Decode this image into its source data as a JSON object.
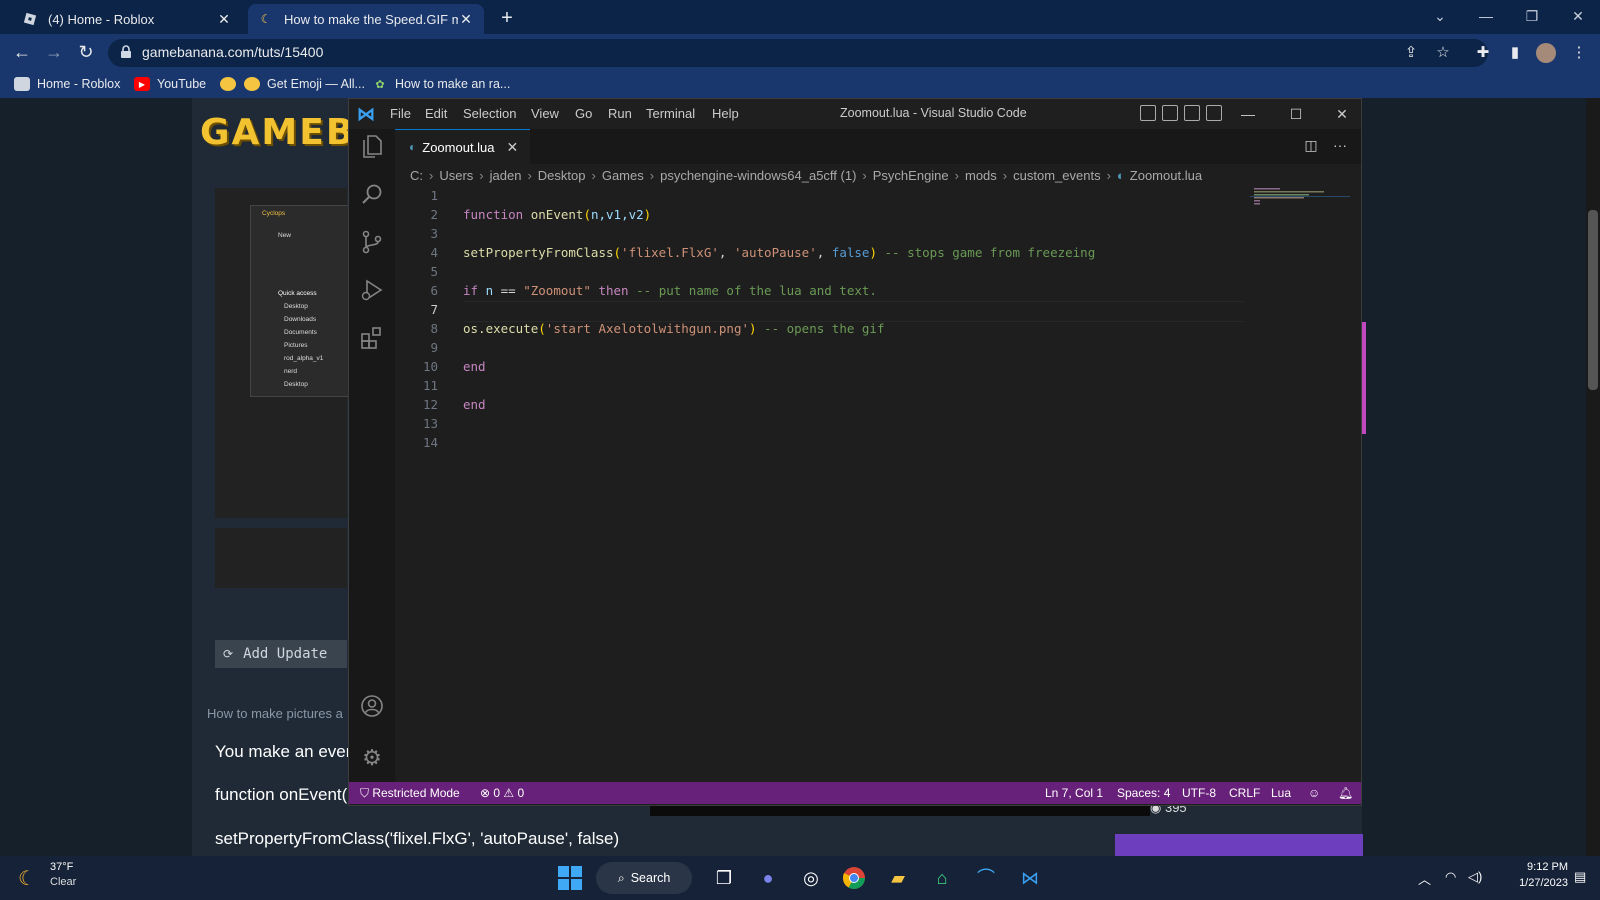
{
  "browser": {
    "tabs": [
      {
        "label": "(4) Home - Roblox",
        "icon": "roblox-icon"
      },
      {
        "label": "How to make the Speed.GIF mec",
        "icon": "moon-icon"
      }
    ],
    "url": "gamebanana.com/tuts/15400",
    "bookmarks": [
      {
        "label": "Home - Roblox",
        "icon": "roblox-icon"
      },
      {
        "label": "YouTube",
        "icon": "youtube-icon"
      },
      {
        "label": "",
        "icon": "emoji-icon"
      },
      {
        "label": "Get Emoji — All...",
        "icon": "emoji-icon"
      },
      {
        "label": "How to make an ra...",
        "icon": "leaf-icon"
      }
    ]
  },
  "webpage": {
    "logo": "GAMEB",
    "add_update": "Add Update",
    "hint": "How to make pictures a",
    "line1": "You make an ever",
    "line2": "function onEvent(",
    "line3": "setPropertyFromClass('flixel.FlxG', 'autoPause', false)",
    "views": "395",
    "explorer": {
      "folder": "Cyclops",
      "new_label": "New",
      "quick_access": "Quick access",
      "items": [
        "Desktop",
        "Downloads",
        "Documents",
        "Pictures",
        "rod_alpha_v1",
        "nerd",
        "Desktop"
      ]
    }
  },
  "vscode": {
    "title": "Zoomout.lua - Visual Studio Code",
    "menu": [
      "File",
      "Edit",
      "Selection",
      "View",
      "Go",
      "Run",
      "Terminal",
      "Help"
    ],
    "tab": "Zoomout.lua",
    "breadcrumbs": [
      "C:",
      "Users",
      "jaden",
      "Desktop",
      "Games",
      "psychengine-windows64_a5cff (1)",
      "PsychEngine",
      "mods",
      "custom_events",
      "Zoomout.lua"
    ],
    "line_numbers": [
      "1",
      "2",
      "3",
      "4",
      "5",
      "6",
      "7",
      "8",
      "9",
      "10",
      "11",
      "12",
      "13",
      "14"
    ],
    "code": {
      "l2_kw": "function",
      "l2_fn": "onEvent",
      "l2_p1": "(",
      "l2_args": "n,v1,v2",
      "l2_p2": ")",
      "l4_fn": "setPropertyFromClass",
      "l4_a": "(",
      "l4_s1": "'flixel.FlxG'",
      "l4_c1": ", ",
      "l4_s2": "'autoPause'",
      "l4_c2": ", ",
      "l4_f": "false",
      "l4_b": ")",
      "l4_cm": " -- stops game from freezeing",
      "l6_if": "if",
      "l6_n": " n ",
      "l6_eq": "== ",
      "l6_s": "\"Zoomout\"",
      "l6_then": " then",
      "l6_cm": " -- put name of the lua and text.",
      "l8_fn": "os.execute",
      "l8_a": "(",
      "l8_s": "'start Axelotolwithgun.png'",
      "l8_b": ")",
      "l8_cm": " -- opens the gif",
      "l10": "end",
      "l12": "end"
    },
    "status": {
      "restricted": "Restricted Mode",
      "errors": "0",
      "warnings": "0",
      "position": "Ln 7, Col 1",
      "spaces": "Spaces: 4",
      "encoding": "UTF-8",
      "eol": "CRLF",
      "language": "Lua"
    }
  },
  "taskbar": {
    "temperature": "37°F",
    "condition": "Clear",
    "search": "Search",
    "time": "9:12 PM",
    "date": "1/27/2023"
  },
  "colors": {
    "statusbar": "#68217a",
    "chrome_frame": "#0b2447",
    "vscode_bg": "#1e1e1e"
  }
}
